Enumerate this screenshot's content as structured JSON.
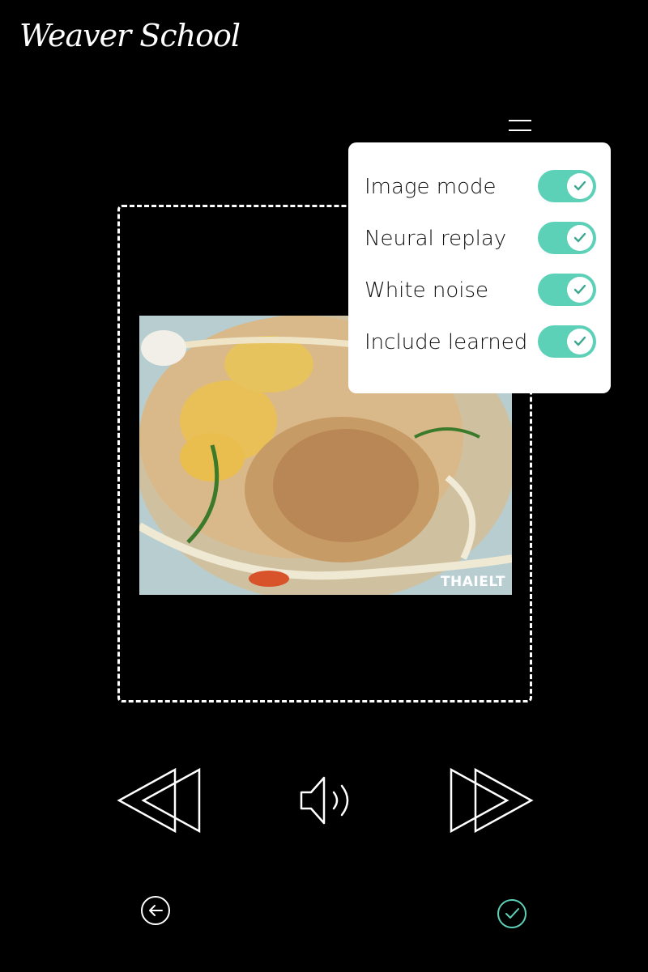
{
  "app": {
    "logo_text": "Weaver School"
  },
  "settings": {
    "items": [
      {
        "label": "Image mode",
        "enabled": true
      },
      {
        "label": "Neural replay",
        "enabled": true
      },
      {
        "label": "White noise",
        "enabled": true
      },
      {
        "label": "Include learned",
        "enabled": true
      }
    ]
  },
  "image": {
    "watermark": "THAIELT"
  },
  "controls": {
    "rewind": "rewind-icon",
    "sound": "speaker-icon",
    "forward": "fast-forward-icon"
  },
  "nav": {
    "back": "back-arrow-icon",
    "confirm": "check-icon"
  },
  "colors": {
    "accent": "#5cd1b8",
    "background": "#000000",
    "panel": "#ffffff"
  }
}
